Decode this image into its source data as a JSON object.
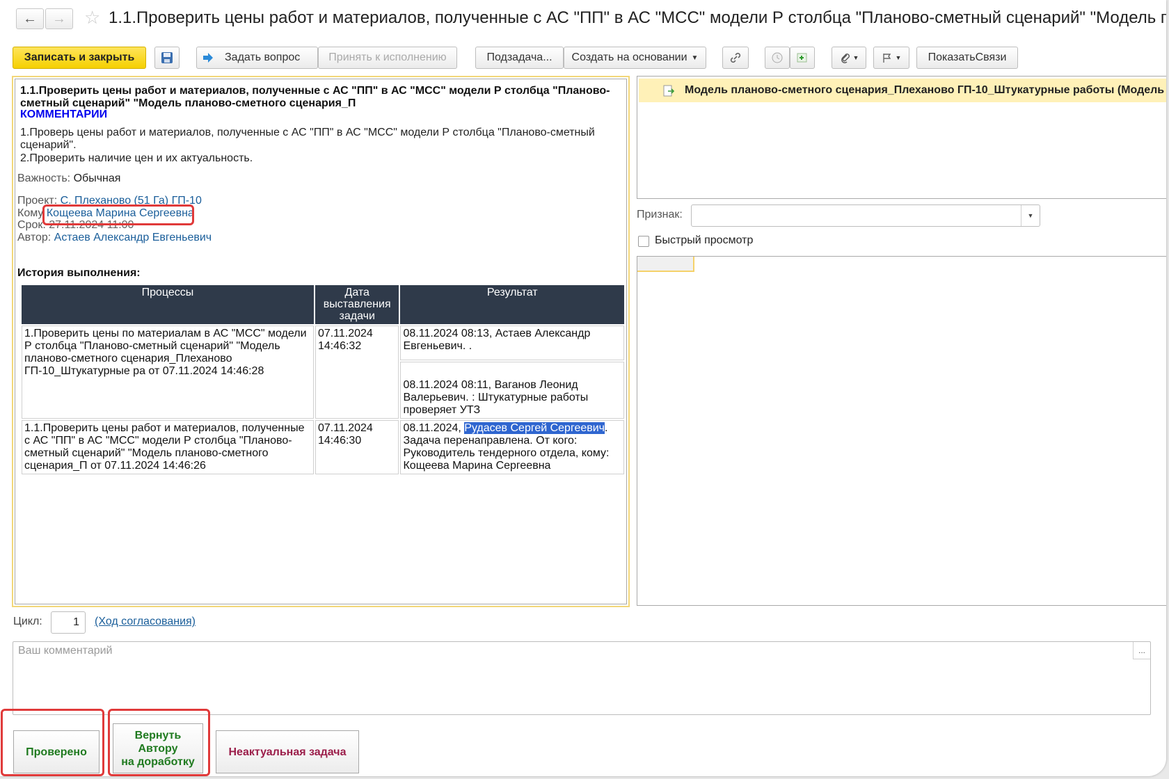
{
  "header": {
    "back_label": "←",
    "forward_label": "→",
    "star_label": "☆",
    "title": "1.1.Проверить цены работ и материалов, полученные с АС \"ПП\" в АС \"МСС\" модели Р столбца \"Планово-сметный сценарий\" \"Модель планово"
  },
  "toolbar": {
    "save_close": "Записать и закрыть",
    "ask_question": "Задать вопрос",
    "accept": "Принять к исполнению",
    "subtask": "Подзадача...",
    "create_based": "Создать на основании",
    "show_links": "ПоказатьСвязи"
  },
  "task": {
    "heading": "1.1.Проверить цены работ и материалов, полученные с АС \"ПП\" в АС \"МСС\" модели Р столбца \"Планово-сметный сценарий\" \"Модель планово-сметного сценария_П",
    "comment_heading": "КОММЕНТАРИИ",
    "comment_line1": "1.Проверь цены работ и материалов, полученные с АС \"ПП\" в АС \"МСС\" модели Р столбца \"Планово-сметный сценарий\".",
    "comment_line2": "2.Проверить наличие цен и их актуальность.",
    "importance_label": "Важность:",
    "importance_value": "Обычная",
    "project_label": "Проект:",
    "project_value": "С. Плеханово (51 Га) ГП-10",
    "to_label": "Кому",
    "to_value": "Кощеева Марина Сергеевна",
    "deadline_label": "Срок:",
    "deadline_value": "27.11.2024 11:00",
    "author_label": "Автор:",
    "author_value": "Астаев Александр Евгеньевич",
    "history_heading": "История выполнения:"
  },
  "history": {
    "columns": [
      "Процессы",
      "Дата выставления задачи",
      "Результат"
    ],
    "rows": [
      {
        "process": "1.Проверить цены по материалам в АС \"МСС\" модели Р столбца \"Планово-сметный сценарий\" \"Модель планово-сметного сценария_Плеханово ГП-10_Штукатурные ра от 07.11.2024 14:46:28",
        "date": "07.11.2024 14:46:32",
        "result1": "08.11.2024 08:13, Астаев Александр Евгеньевич. .",
        "result2": "08.11.2024 08:11, Ваганов Леонид Валерьевич. : Штукатурные работы проверяет УТЗ"
      },
      {
        "process": "1.1.Проверить цены работ и материалов, полученные с АС \"ПП\" в АС \"МСС\" модели Р столбца \"Планово-сметный сценарий\" \"Модель планово-сметного сценария_П от 07.11.2024 14:46:26",
        "date": "07.11.2024 14:46:30",
        "result_prefix": "08.11.2024, ",
        "result_selected": "Рудасев Сергей Сергеевич",
        "result_suffix": ". Задача перенаправлена. От кого: Руководитель тендерного отдела, кому: Кощеева Марина Сергеевна"
      }
    ]
  },
  "right": {
    "related_item": "Модель планово-сметного сценария_Плеханово ГП-10_Штукатурные работы (Модель",
    "sign_label": "Признак:",
    "quick_view_label": "Быстрый просмотр"
  },
  "footer": {
    "cycle_label": "Цикл:",
    "cycle_value": "1",
    "approval_link": "(Ход согласования)",
    "comment_placeholder": "Ваш комментарий",
    "comment_more": "...",
    "btn_checked": "Проверено",
    "btn_return_line1": "Вернуть",
    "btn_return_line2": "Автору",
    "btn_return_line3": "на доработку",
    "btn_irrelevant": "Неактуальная задача"
  },
  "colors": {
    "primary_button": "#f5d000",
    "highlight_frame": "#e03a3a",
    "green_text": "#1f7a1f",
    "maroon_text": "#9b1e4a",
    "table_header": "#2f3a4a"
  }
}
